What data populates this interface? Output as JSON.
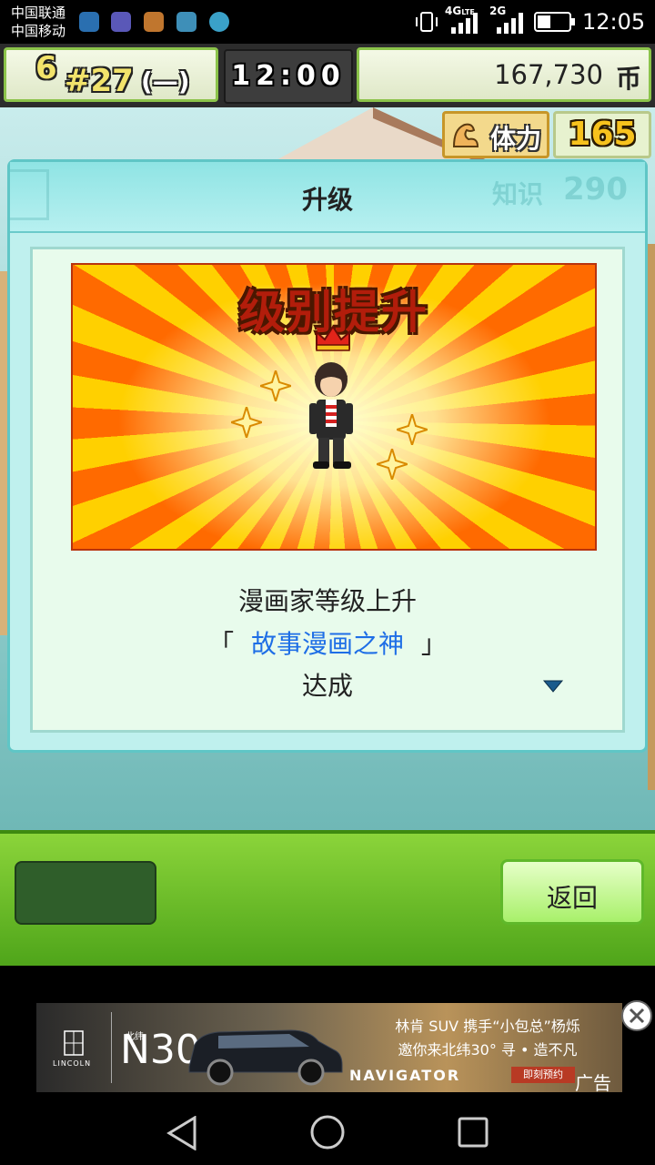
{
  "status_bar": {
    "carrier_1": "中国联通",
    "carrier_2": "中国移动",
    "network_1": "4G",
    "network_1_sub": "LTE",
    "network_2": "2G",
    "time": "12:05"
  },
  "hud": {
    "level": "6",
    "rank": "#27",
    "rank_status": "(—)",
    "game_time": "12:00",
    "money": "167,730",
    "currency_symbol": "币"
  },
  "stats": {
    "stamina_label": "体力",
    "stamina_value": "165",
    "knowledge_label": "知识",
    "knowledge_value": "290"
  },
  "dialog": {
    "title": "升级",
    "banner_title": "级别提升",
    "line1": "漫画家等级上升",
    "bracket_open": "「",
    "rank_name": "故事漫画之神",
    "bracket_close": "」",
    "line3": "达成"
  },
  "bottom": {
    "back_label": "返回"
  },
  "ad": {
    "brand_small": "LINCOLN",
    "north_label": "北纬",
    "model_number": "N30°",
    "headline": "林肯 SUV 携手“小包总”杨烁",
    "subline": "邀你来北纬30° 寻 • 造不凡",
    "navigator": "NAVIGATOR",
    "cta": "即刻预约",
    "ad_tag": "广告"
  },
  "colors": {
    "accent_green": "#8bd43a",
    "dialog_teal": "#bff0ee",
    "rank_blue": "#1e6ee6",
    "banner_red": "#b21d0b"
  }
}
